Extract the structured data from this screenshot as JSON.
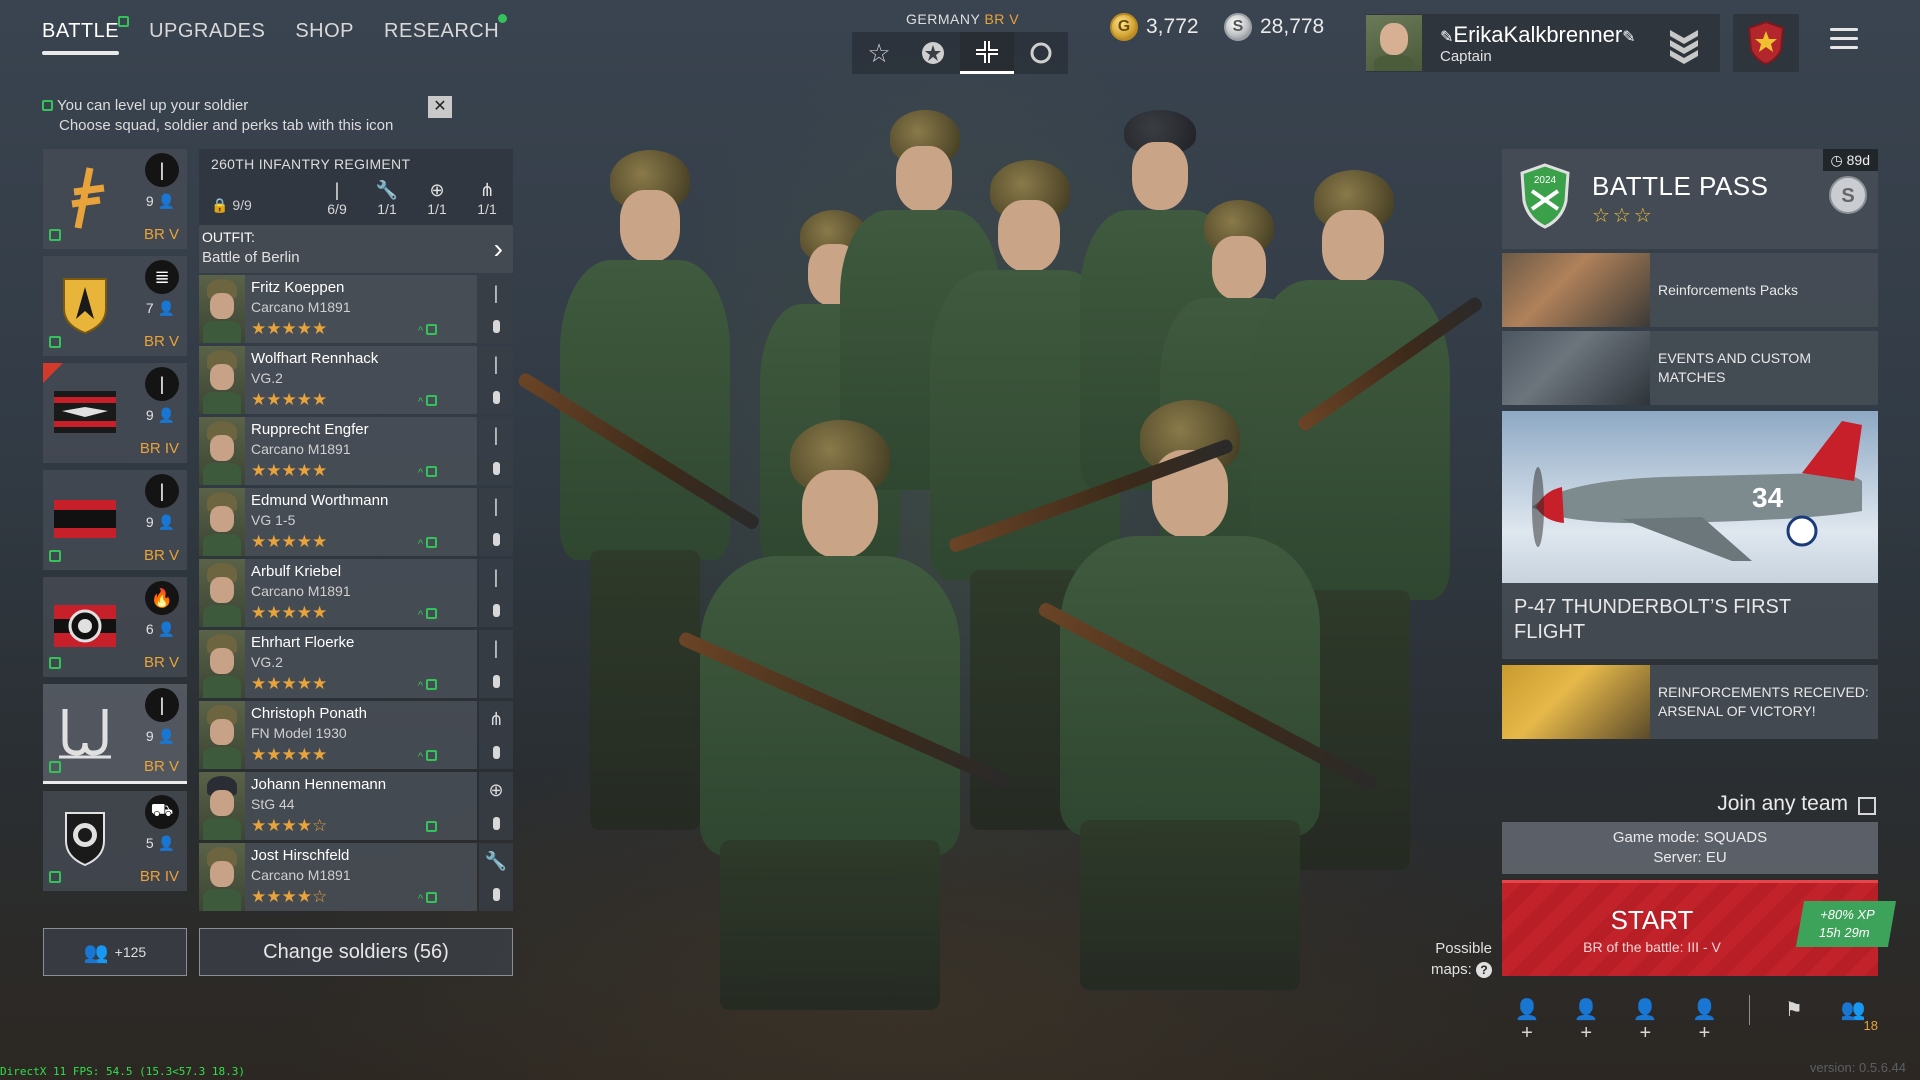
{
  "nav": {
    "tabs": [
      {
        "label": "BATTLE",
        "active": true,
        "badge": "levelup"
      },
      {
        "label": "UPGRADES",
        "active": false
      },
      {
        "label": "SHOP",
        "active": false
      },
      {
        "label": "RESEARCH",
        "active": false,
        "badge": "dot"
      }
    ]
  },
  "hint": {
    "line1": "You can level up your soldier",
    "line2": "Choose squad, soldier and perks tab with this icon",
    "close": "✕"
  },
  "nation": {
    "label": "GERMANY",
    "br": "BR V",
    "options": [
      "star-icon",
      "star-circle-icon",
      "iron-cross-icon",
      "circle-icon"
    ],
    "selected": "iron-cross-icon"
  },
  "currency": {
    "gold": "3,772",
    "silver": "28,778"
  },
  "profile": {
    "name": "ErikaKalkbrenner",
    "rank": "Captain"
  },
  "squads": [
    {
      "icon": "rifle-squad-icon",
      "type": "infantry-icon",
      "count": "9",
      "br": "BR V",
      "upgrade": true,
      "new": false
    },
    {
      "icon": "assault-emblem-icon",
      "type": "assault-icon",
      "count": "7",
      "br": "BR V",
      "upgrade": true,
      "new": false
    },
    {
      "icon": "eagle-stripes-icon",
      "type": "infantry-icon",
      "count": "9",
      "br": "BR IV",
      "upgrade": false,
      "new": true
    },
    {
      "icon": "black-red-flag-icon",
      "type": "infantry-icon",
      "count": "9",
      "br": "BR V",
      "upgrade": true,
      "new": false
    },
    {
      "icon": "wreath-emblem-icon",
      "type": "flamethrower-icon",
      "count": "6",
      "br": "BR V",
      "upgrade": true,
      "new": false
    },
    {
      "icon": "wolfsangel-icon",
      "type": "infantry-icon",
      "count": "9",
      "br": "BR V",
      "upgrade": true,
      "new": false,
      "selected": true
    },
    {
      "icon": "tank-shield-icon",
      "type": "tank-icon",
      "count": "5",
      "br": "BR IV",
      "upgrade": true,
      "new": false
    }
  ],
  "regiment": {
    "title": "260TH INFANTRY REGIMENT",
    "count": "9/9",
    "slots": [
      {
        "icon": "rifle-icon",
        "value": "6/9"
      },
      {
        "icon": "wrench-icon",
        "value": "1/1"
      },
      {
        "icon": "medic-icon",
        "value": "1/1"
      },
      {
        "icon": "ammo-icon",
        "value": "1/1"
      }
    ]
  },
  "outfit": {
    "label": "OUTFIT:",
    "value": "Battle of Berlin"
  },
  "soldiers": [
    {
      "name": "Fritz Koeppen",
      "weapon": "Carcano M1891",
      "stars": "★★★★★",
      "class": "rifle-icon",
      "officer": false
    },
    {
      "name": "Wolfhart Rennhack",
      "weapon": "VG.2",
      "stars": "★★★★★",
      "class": "rifle-icon",
      "officer": false
    },
    {
      "name": "Rupprecht Engfer",
      "weapon": "Carcano M1891",
      "stars": "★★★★★",
      "class": "rifle-icon",
      "officer": false
    },
    {
      "name": "Edmund Worthmann",
      "weapon": "VG 1-5",
      "stars": "★★★★★",
      "class": "rifle-icon",
      "officer": false
    },
    {
      "name": "Arbulf Kriebel",
      "weapon": "Carcano M1891",
      "stars": "★★★★★",
      "class": "rifle-icon",
      "officer": false
    },
    {
      "name": "Ehrhart Floerke",
      "weapon": "VG.2",
      "stars": "★★★★★",
      "class": "rifle-icon",
      "officer": false
    },
    {
      "name": "Christoph Ponath",
      "weapon": "FN Model 1930",
      "stars": "★★★★★",
      "class": "ammo-icon",
      "officer": false
    },
    {
      "name": "Johann Hennemann",
      "weapon": "StG 44",
      "stars": "★★★★☆",
      "class": "medic-icon",
      "officer": true
    },
    {
      "name": "Jost Hirschfeld",
      "weapon": "Carcano M1891",
      "stars": "★★★★☆",
      "class": "wrench-icon",
      "officer": false
    }
  ],
  "bottom_left": {
    "add_squad": "+125",
    "change_soldiers": "Change soldiers (56)"
  },
  "battle_pass": {
    "title": "BATTLE PASS",
    "stars": "☆☆☆",
    "timer": "89d",
    "year": "2024"
  },
  "feed": [
    {
      "text": "Reinforcements Packs"
    },
    {
      "text": "EVENTS AND CUSTOM MATCHES"
    },
    {
      "text": "P-47 THUNDERBOLT’S FIRST FLIGHT"
    },
    {
      "text": "REINFORCEMENTS RECEIVED: ARSENAL OF VICTORY!"
    }
  ],
  "plane_marking": "34",
  "join": {
    "label": "Join any team",
    "checked": false
  },
  "mode": {
    "line1": "Game mode: SQUADS",
    "line2": "Server: EU"
  },
  "start": {
    "label": "START",
    "sub": "BR of the battle: III - V",
    "xp": "+80% XP",
    "xp_time": "15h 29m"
  },
  "possible_maps": {
    "line1": "Possible",
    "line2": "maps:",
    "q": "?"
  },
  "bottom_icons": {
    "friends_count": "18"
  },
  "debug": {
    "fps": "DirectX 11 FPS: 54.5 (15.3<57.3 18.3)",
    "version": "version: 0.5.6.44"
  },
  "colors": {
    "accent_orange": "#e8a33a",
    "upgrade_green": "#35c25b",
    "start_red": "#c2222a",
    "xp_green": "#3ea35a"
  }
}
